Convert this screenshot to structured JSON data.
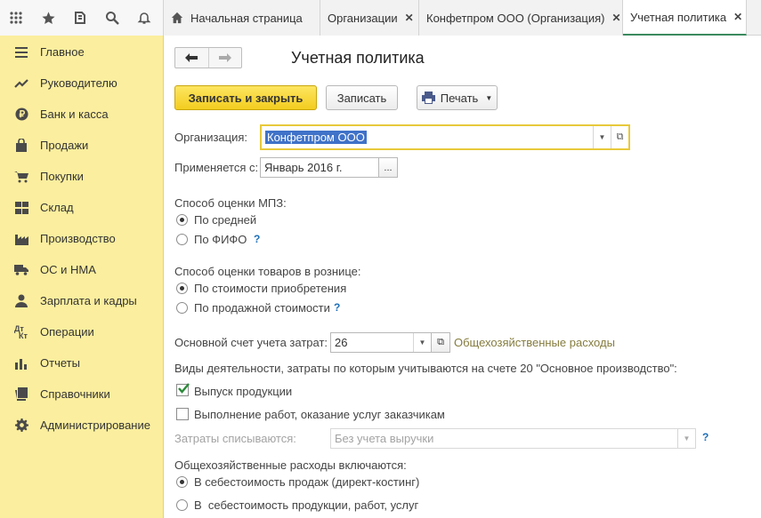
{
  "tabs": [
    {
      "label": "Начальная страница",
      "closable": false
    },
    {
      "label": "Организации",
      "closable": true
    },
    {
      "label": "Конфетпром ООО (Организация)",
      "closable": true
    },
    {
      "label": "Учетная политика",
      "closable": true,
      "active": true
    }
  ],
  "top_icons": [
    "apps-grid-icon",
    "star-icon",
    "history-icon",
    "search-icon",
    "bell-icon"
  ],
  "sidebar": {
    "items": [
      {
        "label": "Главное",
        "icon": "menu-icon"
      },
      {
        "label": "Руководителю",
        "icon": "trend-icon"
      },
      {
        "label": "Банк и касса",
        "icon": "ruble-icon"
      },
      {
        "label": "Продажи",
        "icon": "bag-icon"
      },
      {
        "label": "Покупки",
        "icon": "cart-icon"
      },
      {
        "label": "Склад",
        "icon": "warehouse-icon"
      },
      {
        "label": "Производство",
        "icon": "factory-icon"
      },
      {
        "label": "ОС и НМА",
        "icon": "truck-icon"
      },
      {
        "label": "Зарплата и кадры",
        "icon": "person-icon"
      },
      {
        "label": "Операции",
        "icon": "dt-kt-icon"
      },
      {
        "label": "Отчеты",
        "icon": "bar-chart-icon"
      },
      {
        "label": "Справочники",
        "icon": "books-icon"
      },
      {
        "label": "Администрирование",
        "icon": "gear-icon"
      }
    ]
  },
  "form": {
    "title": "Учетная политика",
    "save_close_label": "Записать и закрыть",
    "save_label": "Записать",
    "print_label": "Печать",
    "org_label": "Организация:",
    "org_value": "Конфетпром ООО",
    "applies_label": "Применяется с:",
    "applies_value": "Январь 2016 г.",
    "applies_btn": "...",
    "mpz_label": "Способ оценки МПЗ:",
    "mpz_options": [
      {
        "label": "По средней",
        "selected": true
      },
      {
        "label": "По ФИФО",
        "selected": false,
        "help": "?"
      }
    ],
    "retail_label": "Способ оценки товаров в рознице:",
    "retail_options": [
      {
        "label": "По стоимости приобретения",
        "selected": true
      },
      {
        "label": "По продажной стоимости",
        "selected": false,
        "help": "?"
      }
    ],
    "account_label": "Основной счет учета затрат:",
    "account_value": "26",
    "account_link": "Общехозяйственные расходы",
    "activities_label": "Виды деятельности, затраты по которым учитываются на счете 20 \"Основное производство\":",
    "activities": [
      {
        "label": "Выпуск продукции",
        "checked": true
      },
      {
        "label": "Выполнение работ, оказание услуг заказчикам",
        "checked": false
      }
    ],
    "writeoff_label": "Затраты списываются:",
    "writeoff_value": "Без учета выручки",
    "writeoff_help": "?",
    "overhead_label": "Общехозяйственные расходы включаются:",
    "overhead_options": [
      {
        "label": "В себестоимость продаж (директ-костинг)",
        "selected": true
      },
      {
        "label": "В  себестоимость продукции, работ, услуг",
        "selected": false
      }
    ]
  },
  "colors": {
    "sidebar": "#fbee9e",
    "primary_button": "#f3cd1f",
    "focus_border": "#e8c93a",
    "link": "#857c3e",
    "help": "#1e70b8"
  }
}
